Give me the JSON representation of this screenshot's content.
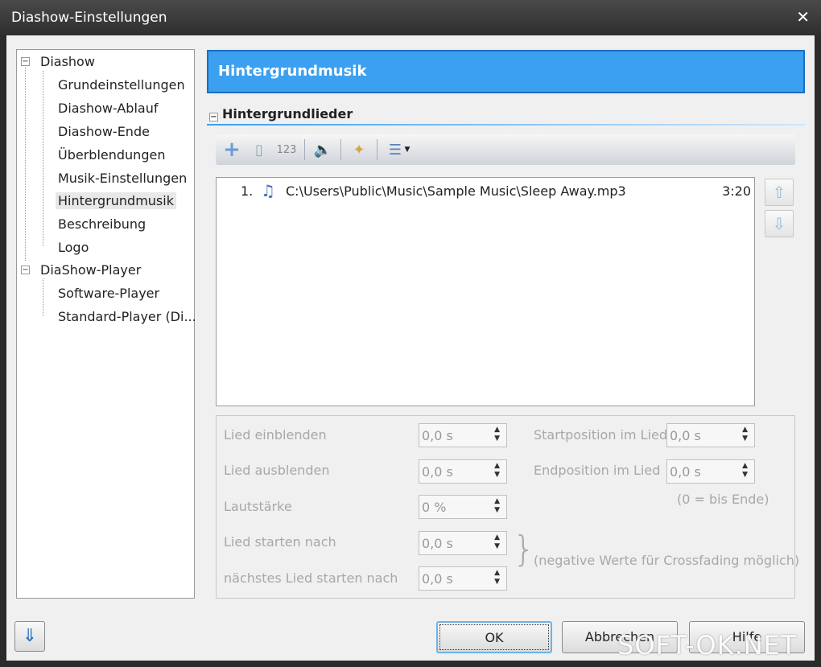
{
  "window": {
    "title": "Diashow-Einstellungen",
    "close_icon": "close-icon"
  },
  "tree": {
    "groups": [
      {
        "label": "Diashow",
        "items": [
          "Grundeinstellungen",
          "Diashow-Ablauf",
          "Diashow-Ende",
          "Überblendungen",
          "Musik-Einstellungen",
          "Hintergrundmusik",
          "Beschreibung",
          "Logo"
        ]
      },
      {
        "label": "DiaShow-Player",
        "items": [
          "Software-Player",
          "Standard-Player (Di..."
        ]
      }
    ],
    "selected": "Hintergrundmusik"
  },
  "header": {
    "title": "Hintergrundmusik"
  },
  "section": {
    "title": "Hintergrundlieder"
  },
  "toolbar": {
    "icons": [
      "add-icon",
      "delete-icon",
      "numbering-icon",
      "volume-icon",
      "wizard-icon",
      "list-view-icon",
      "dropdown-arrow-icon"
    ]
  },
  "playlist": [
    {
      "index": "1.",
      "path": "C:\\Users\\Public\\Music\\Sample Music\\Sleep Away.mp3",
      "duration": "3:20"
    }
  ],
  "props": {
    "fade_in": {
      "label": "Lied einblenden",
      "value": "0,0 s"
    },
    "fade_out": {
      "label": "Lied ausblenden",
      "value": "0,0 s"
    },
    "volume": {
      "label": "Lautstärke",
      "value": "0 %"
    },
    "start_after": {
      "label": "Lied starten nach",
      "value": "0,0 s"
    },
    "next_after": {
      "label": "nächstes Lied starten nach",
      "value": "0,0 s"
    },
    "start_pos": {
      "label": "Startposition im Lied",
      "value": "0,0 s"
    },
    "end_pos": {
      "label": "Endposition im Lied",
      "value": "0,0 s"
    },
    "end_hint": "(0 = bis Ende)",
    "crossfade_hint": "(negative Werte für Crossfading möglich)"
  },
  "buttons": {
    "ok": "OK",
    "cancel": "Abbrechen",
    "help": "Hilfe"
  },
  "watermark": "SOFT-OK.NET"
}
